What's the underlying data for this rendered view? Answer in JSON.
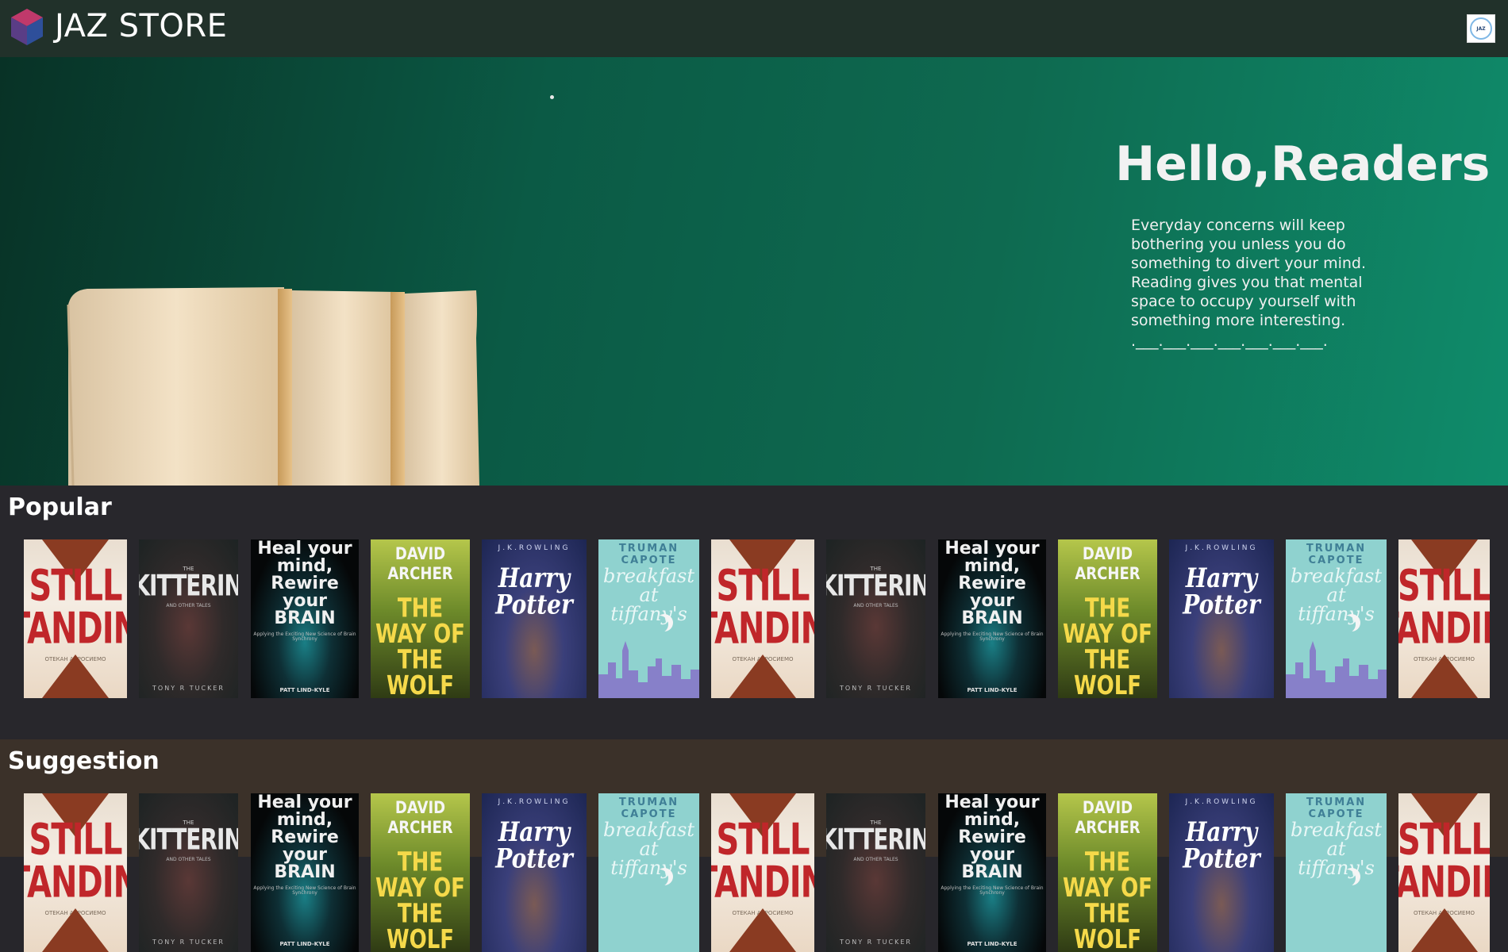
{
  "header": {
    "brand": "JAZ STORE",
    "logo_icon": "cube-logo-icon",
    "avatar_icon": "jaz-avatar-icon",
    "avatar_text": "JAZ"
  },
  "hero": {
    "title": "Hello,Readers :)",
    "description": "Everyday concerns will keep bothering you unless you do something to divert your mind. Reading gives you that mental space to occupy yourself with something more interesting.",
    "divider": ".___.___.___.___.___.___.___."
  },
  "sections": [
    {
      "title": "Popular"
    },
    {
      "title": "Suggestion"
    }
  ],
  "books": {
    "still": {
      "title": "STILL STANDING",
      "author": "ОТЕКАН АКРОСИЕМО"
    },
    "skit": {
      "pre": "THE",
      "title": "SKITTERING",
      "sub": "AND OTHER TALES",
      "author": "TONY R TUCKER"
    },
    "heal": {
      "title": "Heal your mind, Rewire your BRAIN",
      "sub": "Applying the Exciting New Science of Brain Synchrony",
      "author": "PATT LIND-KYLE"
    },
    "wolf": {
      "author": "DAVID ARCHER",
      "title": "THE WAY OF THE WOLF"
    },
    "hp": {
      "author": "J.K.ROWLING",
      "title": "Harry Potter"
    },
    "tiff": {
      "author": "TRUMAN CAPOTE",
      "title": "breakfast at tiffany's"
    }
  },
  "colors": {
    "header_bg": "#21312a",
    "hero_start": "#083226",
    "hero_end": "#0f8c6b",
    "popular_bg": "#28272c",
    "suggestion_bg": "#3b3129"
  }
}
